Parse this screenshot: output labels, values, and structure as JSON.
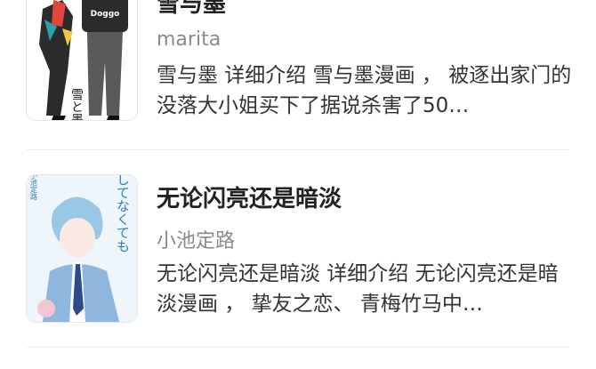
{
  "items": [
    {
      "title": "雪与墨",
      "author": "marita",
      "description": "雪与墨 详细介绍 雪与墨漫画 ， 被逐出家门的没落大小姐买下了据说杀害了50…",
      "cover": {
        "label_text": "Doggo",
        "japanese_text": "雪と墨",
        "colors": {
          "bg": "#ffffff",
          "jacket": "#2b2b2b",
          "pants": "#555555",
          "accent_red": "#e0463a",
          "accent_teal": "#2aa0a8"
        }
      }
    },
    {
      "title": "无论闪亮还是暗淡",
      "author": "小池定路",
      "description": "无论闪亮还是暗淡 详细介绍 无论闪亮还是暗淡漫画 ， 挚友之恋、 青梅竹马中…",
      "cover": {
        "japanese_text": "キラキラしてなくても",
        "author_text": "小池定路",
        "colors": {
          "bg": "#eef6fb",
          "suit": "#8fb6dc",
          "hair": "#9bc7e6",
          "tie": "#2e4a8a",
          "pink": "#f3c6d4"
        }
      }
    }
  ]
}
